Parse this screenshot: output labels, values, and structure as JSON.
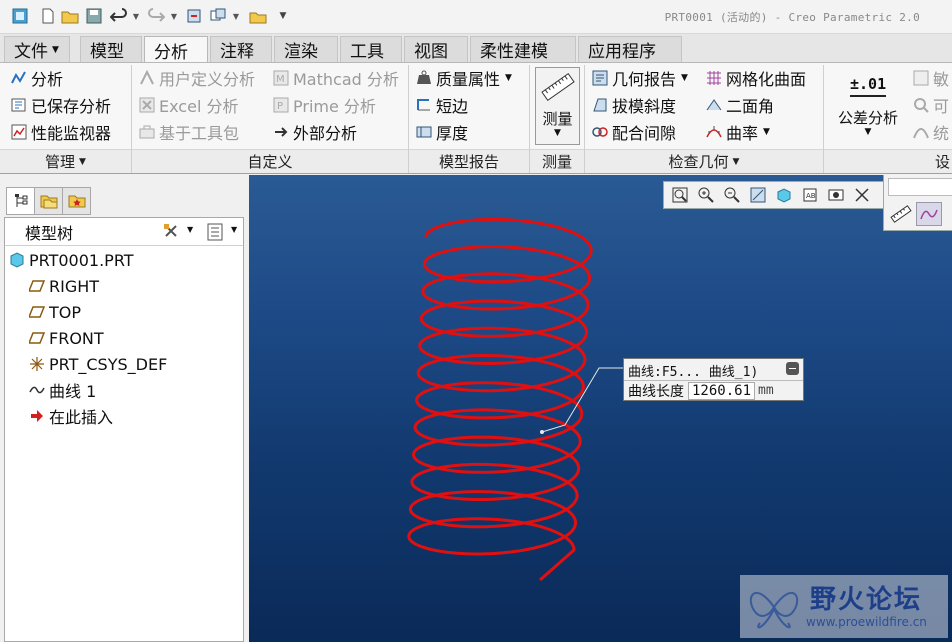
{
  "window": {
    "title": "PRT0001 (活动的) - Creo Parametric 2.0"
  },
  "tabs": [
    {
      "label": "文件",
      "has_menu": true
    },
    {
      "label": "模型"
    },
    {
      "label": "分析",
      "active": true
    },
    {
      "label": "注释"
    },
    {
      "label": "渲染"
    },
    {
      "label": "工具"
    },
    {
      "label": "视图"
    },
    {
      "label": "柔性建模"
    },
    {
      "label": "应用程序"
    }
  ],
  "ribbon": {
    "manage": {
      "label": "管理",
      "items": [
        "分析",
        "已保存分析",
        "性能监视器"
      ]
    },
    "custom": {
      "label": "自定义",
      "items": [
        "用户定义分析",
        "Excel 分析",
        "基于工具包",
        "Mathcad 分析",
        "Prime 分析",
        "外部分析"
      ]
    },
    "model_report": {
      "label": "模型报告",
      "items": [
        "质量属性",
        "短边",
        "厚度"
      ]
    },
    "measure": {
      "label": "测量",
      "button": "测量"
    },
    "inspect_geometry": {
      "label": "检查几何",
      "items": [
        "几何报告",
        "拔模斜度",
        "配合间隙",
        "网格化曲面",
        "二面角",
        "曲率"
      ]
    },
    "tolerance": {
      "button": "公差分析",
      "icon_text": "±.01"
    },
    "partial": {
      "items": [
        "敏",
        "可",
        "统"
      ],
      "label": "设"
    }
  },
  "model_tree": {
    "title": "模型树",
    "items": [
      {
        "label": "PRT0001.PRT",
        "icon": "part-icon"
      },
      {
        "label": "RIGHT",
        "icon": "datum-plane-icon"
      },
      {
        "label": "TOP",
        "icon": "datum-plane-icon"
      },
      {
        "label": "FRONT",
        "icon": "datum-plane-icon"
      },
      {
        "label": "PRT_CSYS_DEF",
        "icon": "csys-icon"
      },
      {
        "label": "曲线 1",
        "icon": "curve-icon"
      },
      {
        "label": "在此插入",
        "icon": "insert-arrow-icon"
      }
    ]
  },
  "annotation": {
    "title": "曲线:F5... 曲线_1)",
    "label": "曲线长度",
    "value": "1260.61",
    "unit": "mm"
  },
  "watermark": {
    "text": "野火论坛",
    "url": "www.proewildfire.cn"
  },
  "colors": {
    "helix": "#e01010",
    "viewport_top": "#2a5a94",
    "viewport_bottom": "#0a2a58"
  }
}
